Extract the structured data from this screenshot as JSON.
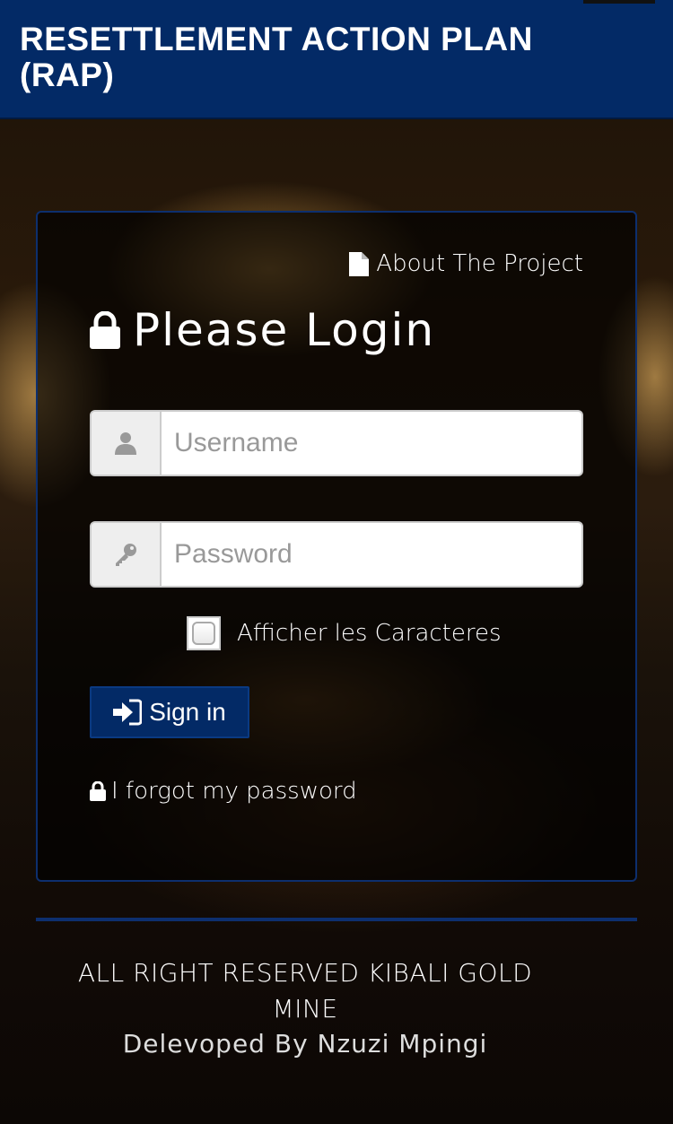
{
  "header": {
    "title": "RESETTLEMENT ACTION PLAN (RAP)",
    "background_color": "#032a66"
  },
  "login": {
    "about_link": "About The Project",
    "about_icon": "file-icon",
    "title": "Please Login",
    "title_icon": "lock-icon",
    "username": {
      "placeholder": "Username",
      "value": "",
      "icon": "user-icon"
    },
    "password": {
      "placeholder": "Password",
      "value": "",
      "icon": "key-icon"
    },
    "show_characters": {
      "label": "Afficher les Caracteres",
      "checked": false
    },
    "sign_in_label": "Sign in",
    "sign_in_icon": "sign-in-icon",
    "forgot_password_label": "I forgot my password",
    "forgot_password_icon": "lock-icon"
  },
  "footer": {
    "copyright": "ALL RIGHT RESERVED KIBALI GOLD MINE",
    "developer": "Delevoped By Nzuzi Mpingi"
  },
  "colors": {
    "accent": "#032a66",
    "panel_border": "#0d2f6e"
  }
}
